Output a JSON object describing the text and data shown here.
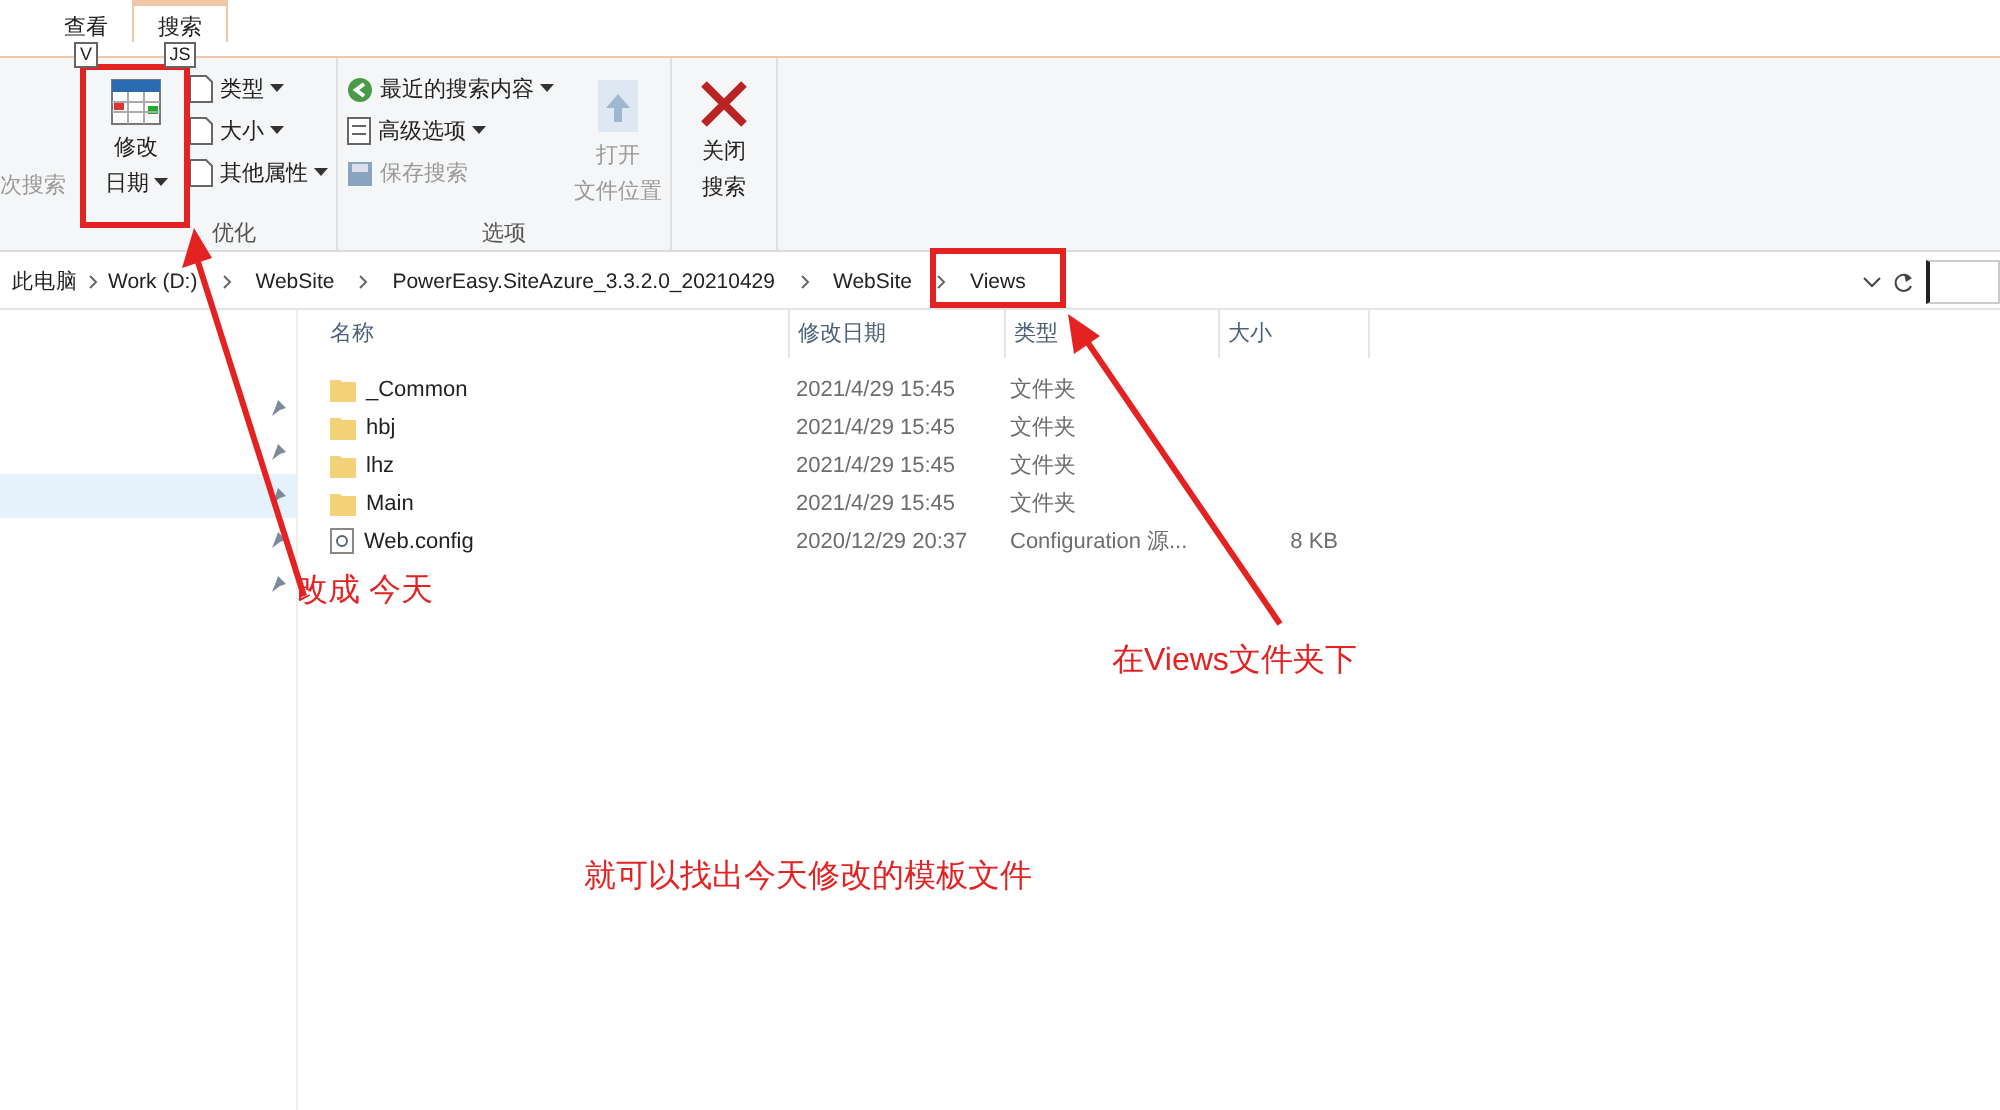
{
  "tabs": [
    {
      "label": "查看",
      "key_tip": "V",
      "selected": false
    },
    {
      "label": "搜索",
      "key_tip": "JS",
      "selected": true
    }
  ],
  "ribbon": {
    "partial_button": {
      "label": "次搜索",
      "disabled": true
    },
    "groups": [
      {
        "label": "优化",
        "big": [
          {
            "label": "修改",
            "label2": "日期",
            "kind": "calendar",
            "disabled": false
          }
        ],
        "small": [
          {
            "label": "类型",
            "kind": "doc",
            "disabled": false
          },
          {
            "label": "大小",
            "kind": "doc",
            "disabled": false
          },
          {
            "label": "其他属性",
            "kind": "doc",
            "disabled": false
          }
        ]
      },
      {
        "label": "选项",
        "small": [
          {
            "label": "最近的搜索内容",
            "kind": "recent",
            "disabled": false
          },
          {
            "label": "高级选项",
            "kind": "list",
            "disabled": false
          },
          {
            "label": "保存搜索",
            "kind": "save",
            "disabled": true
          }
        ],
        "big": [
          {
            "label": "打开",
            "label2": "文件位置",
            "kind": "open",
            "disabled": true
          }
        ]
      },
      {
        "big": [
          {
            "label": "关闭",
            "label2": "搜索",
            "kind": "close",
            "disabled": false
          }
        ]
      }
    ]
  },
  "breadcrumb": [
    "此电脑",
    "Work (D:)",
    "WebSite",
    "PowerEasy.SiteAzure_3.3.2.0_20210429",
    "WebSite",
    "Views"
  ],
  "columns": [
    "名称",
    "修改日期",
    "类型",
    "大小"
  ],
  "files": [
    {
      "name": "_Common",
      "date": "2021/4/29 15:45",
      "type": "文件夹",
      "kind": "folder"
    },
    {
      "name": "hbj",
      "date": "2021/4/29 15:45",
      "type": "文件夹",
      "kind": "folder"
    },
    {
      "name": "lhz",
      "date": "2021/4/29 15:45",
      "type": "文件夹",
      "kind": "folder"
    },
    {
      "name": "Main",
      "date": "2021/4/29 15:45",
      "type": "文件夹",
      "kind": "folder"
    },
    {
      "name": "Web.config",
      "date": "2020/12/29 20:37",
      "type": "Configuration 源...",
      "size": "8 KB",
      "kind": "config"
    }
  ],
  "nav_rows": [
    {
      "selected": false
    },
    {
      "selected": false
    },
    {
      "selected": true
    },
    {
      "selected": false
    },
    {
      "selected": false
    }
  ],
  "annotations": [
    "改成 今天",
    "在Views文件夹下",
    "就可以找出今天修改的模板文件"
  ]
}
